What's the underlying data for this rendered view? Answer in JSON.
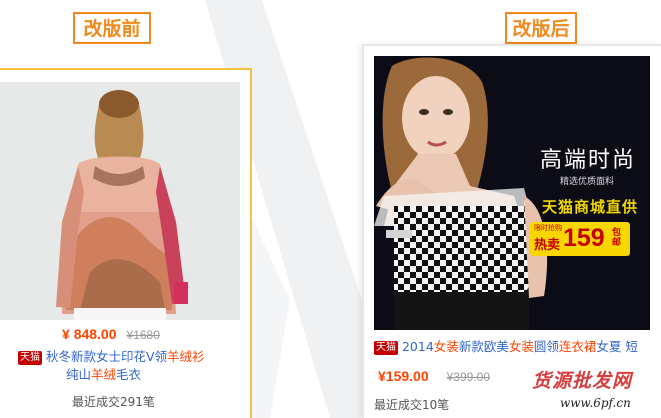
{
  "labels": {
    "before": "改版前",
    "after": "改版后"
  },
  "before_card": {
    "price_symbol": "¥",
    "price": "848.00",
    "original_price": "¥1680",
    "shop_tag": "天猫",
    "title_parts": [
      "秋冬新款女士印花V领",
      "羊绒衫",
      " ",
      "纯山",
      "羊绒",
      "毛衣"
    ],
    "sold": "最近成交291笔"
  },
  "after_card": {
    "banner_title": "高端时尚",
    "banner_subtitle": "精选优质面料",
    "banner_shop": "天猫商城直供",
    "promo_small": "限时抢购",
    "promo_label": "热卖",
    "promo_price": "159",
    "promo_suffix": "包邮",
    "price_symbol": "¥",
    "price": "159.00",
    "original_price": "¥399.00",
    "shop_tag": "天猫",
    "title_parts": [
      "2014",
      "女装",
      "新款",
      "欧美",
      "女装",
      "圆领",
      "连衣裙",
      "女夏",
      " 短"
    ],
    "sold": "最近成交10笔"
  },
  "watermark": {
    "text": "货源批发网",
    "url": "www.6pf.cn"
  },
  "colors": {
    "accent": "#f08a1e",
    "price": "#ff4400",
    "link": "#3366cc",
    "tmall": "#c40000"
  }
}
